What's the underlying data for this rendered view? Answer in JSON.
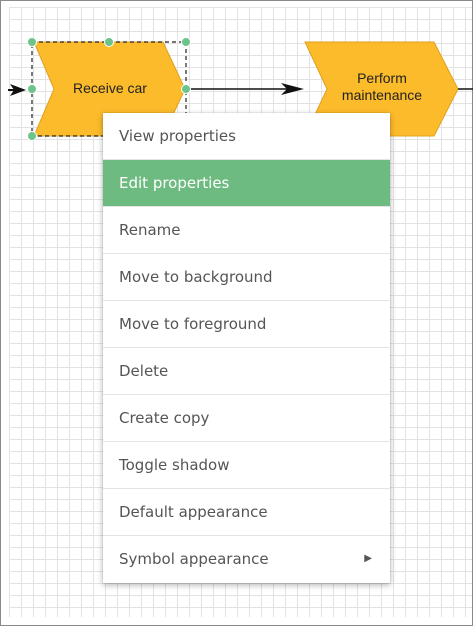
{
  "diagram": {
    "shapes": [
      {
        "label": "Receive car"
      },
      {
        "label_line1": "Perform",
        "label_line2": "maintenance"
      }
    ]
  },
  "context_menu": {
    "items": [
      {
        "label": "View properties"
      },
      {
        "label": "Edit properties"
      },
      {
        "label": "Rename"
      },
      {
        "label": "Move to background"
      },
      {
        "label": "Move to foreground"
      },
      {
        "label": "Delete"
      },
      {
        "label": "Create copy"
      },
      {
        "label": "Toggle shadow"
      },
      {
        "label": "Default appearance"
      },
      {
        "label": "Symbol appearance",
        "submenu_icon": "triangle-right-icon"
      }
    ]
  },
  "colors": {
    "shape_fill": "#fbbb2a",
    "highlight": "#6dbb80",
    "handle": "#6cc48a"
  }
}
